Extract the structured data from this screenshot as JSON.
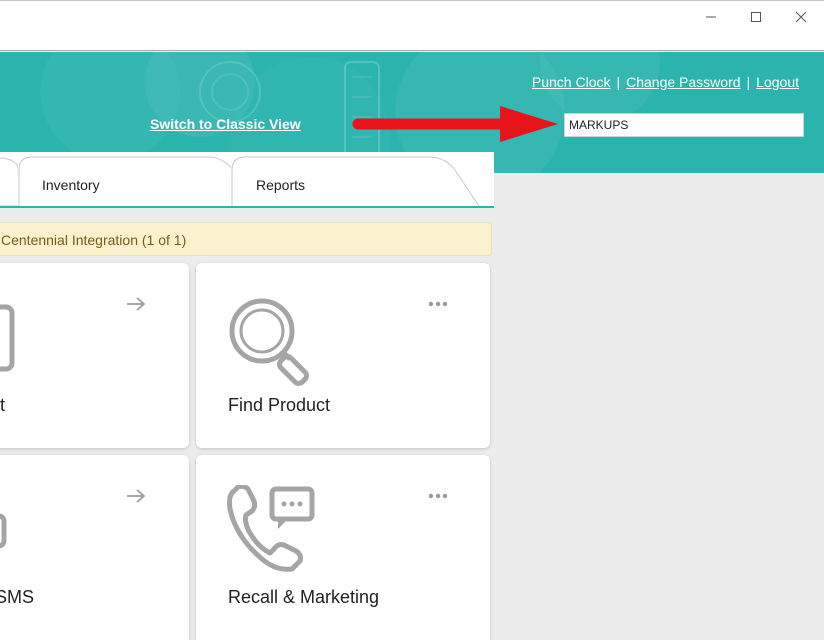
{
  "header": {
    "links": {
      "punch_clock": "Punch Clock",
      "change_password": "Change Password",
      "logout": "Logout",
      "separator": "|"
    },
    "switch_classic": "Switch to Classic View",
    "search_value": "MARKUPS"
  },
  "tabs": [
    {
      "label": ""
    },
    {
      "label": "Inventory"
    },
    {
      "label": "Reports"
    }
  ],
  "banner": {
    "text": "Centennial Integration (1 of 1)"
  },
  "cards": [
    {
      "label": "ent",
      "action_icon": "arrow-right-icon"
    },
    {
      "label": "Find Product",
      "action_icon": "more-dots-icon"
    },
    {
      "label": "d SMS",
      "action_icon": "arrow-right-icon"
    },
    {
      "label": "Recall & Marketing",
      "action_icon": "more-dots-icon"
    }
  ],
  "colors": {
    "teal": "#2bb3ae",
    "banner_bg": "#fbf1cf",
    "annotation_arrow": "#e8141a",
    "icon_gray": "#a5a5a5"
  }
}
